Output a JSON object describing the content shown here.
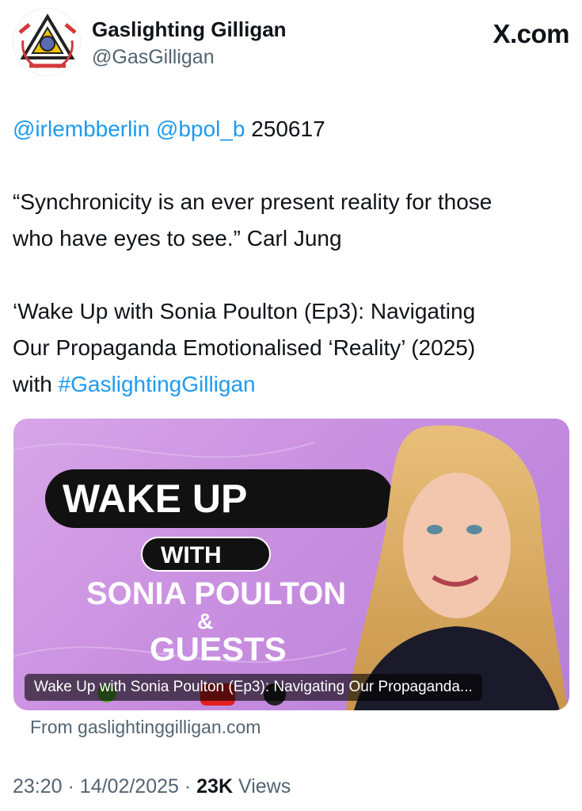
{
  "author": {
    "name": "Gaslighting Gilligan",
    "handle": "@GasGilligan"
  },
  "brand": "X.com",
  "tweet": {
    "mention_1": "@irlembberlin",
    "mention_2": "@bpol_b",
    "code": "250617",
    "quote_line_1": "“Synchronicity is an ever present reality for those",
    "quote_line_2": "who have eyes to see.” Carl Jung",
    "body_line_1": "‘Wake Up with Sonia Poulton (Ep3): Navigating",
    "body_line_2": "Our Propaganda Emotionalised ‘Reality’ (2025)",
    "body_line_3_prefix": "with",
    "hashtag": "#GaslightingGilligan"
  },
  "card": {
    "thumb_title": "WAKE UP",
    "thumb_with": "WITH",
    "thumb_name": "SONIA POULTON",
    "thumb_amp": "&",
    "thumb_guests": "GUESTS",
    "caption": "Wake Up with Sonia Poulton (Ep3): Navigating Our Propaganda...",
    "source": "From gaslightinggilligan.com"
  },
  "meta": {
    "time": "23:20",
    "sep1": "·",
    "date": "14/02/2025",
    "sep2": "·",
    "views_count": "23K",
    "views_label": "Views"
  },
  "colors": {
    "link": "#1d9bf0",
    "card_bg": "#c98fe0",
    "secondary_text": "#536471"
  }
}
